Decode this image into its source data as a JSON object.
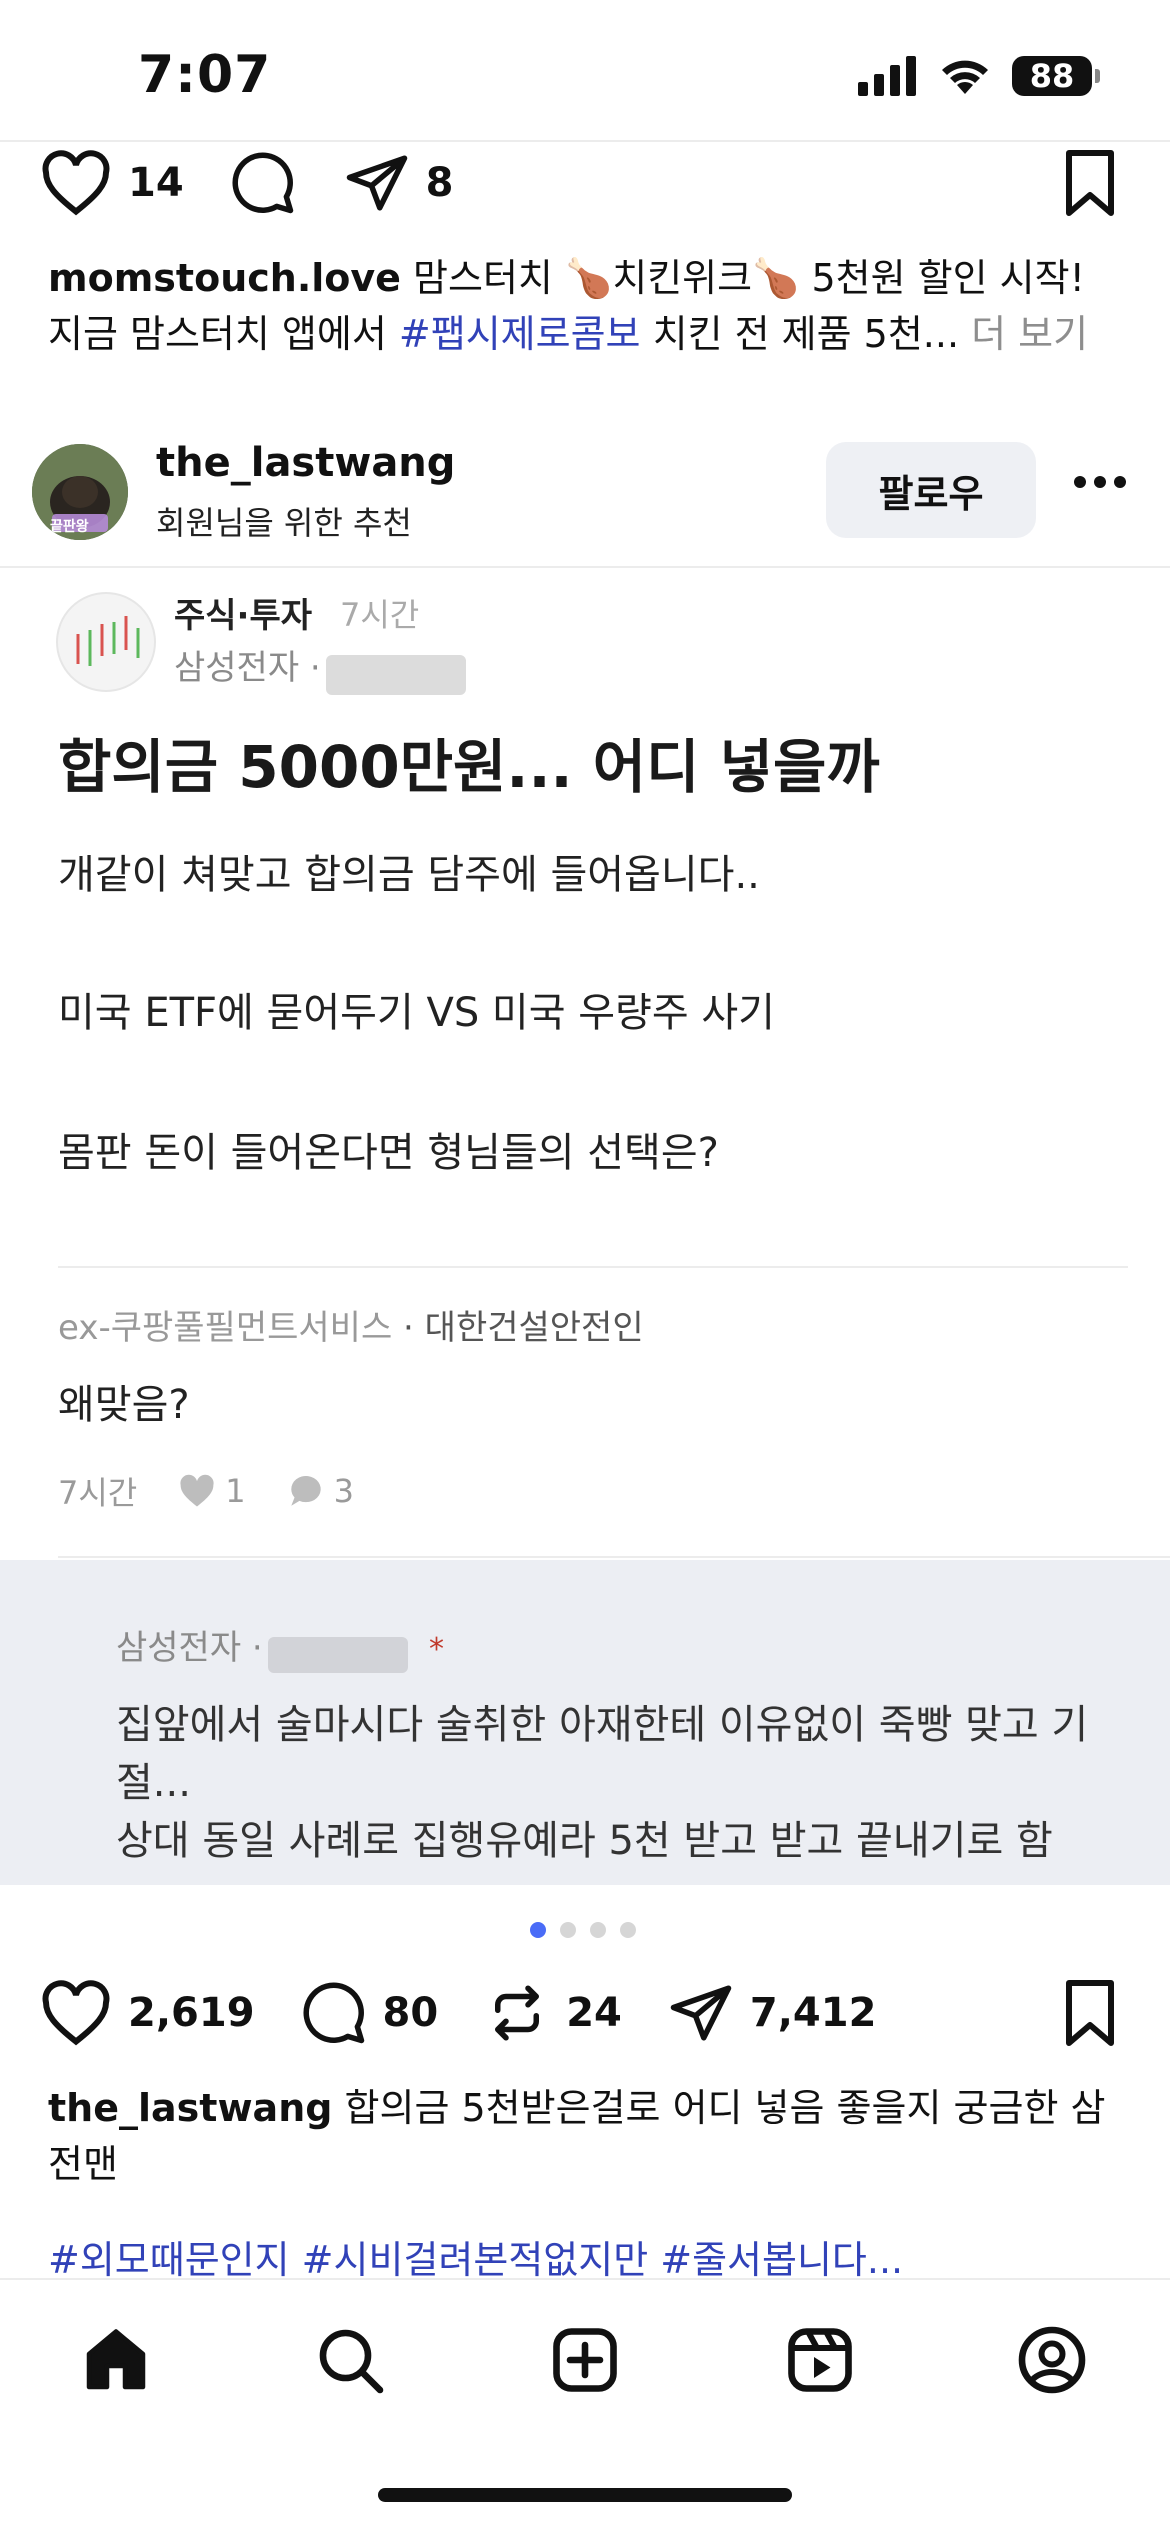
{
  "status": {
    "time": "7:07",
    "battery": "88"
  },
  "post1": {
    "likes": "14",
    "shares": "8",
    "caption_user": "momstouch.love",
    "caption_line1": "맘스터치 🍗치킨위크🍗 5천원 할인 시작!",
    "caption_line2_pre": "지금 맘스터치 앱에서",
    "caption_hashtag": "#팹시제로콤보",
    "caption_line2_post": "치킨 전 제품 5천...",
    "more": "더 보기"
  },
  "post2": {
    "username": "the_lastwang",
    "subtitle": "회원님을 위한 추천",
    "follow_label": "팔로우",
    "avatar_tag": "끝판왕",
    "card": {
      "board": "주식·투자",
      "time": "7시간",
      "company": "삼성전자 ·",
      "title": "합의금 5000만원... 어디 넣을까",
      "body_line1": "개같이 쳐맞고 합의금 담주에 들어옵니다..",
      "body_line2": "미국 ETF에 묻어두기 VS 미국 우량주 사기",
      "body_line3": "몸판 돈이 들어온다면 형님들의 선택은?",
      "comment_author": "ex-쿠팡풀필먼트서비스",
      "comment_author2": "· 대한건설안전인",
      "comment_text": "왜맞음?",
      "comment_time": "7시간",
      "comment_likes": "1",
      "comment_replies": "3",
      "reply_company": "삼성전자 ·",
      "reply_star": "*",
      "reply_line1": "집앞에서 술마시다 술취한 아재한테 이유없이 죽빵 맞고 기",
      "reply_line2": "절...",
      "reply_line3": "상대 동일 사례로 집행유예라 5천 받고 받고 끝내기로 함"
    },
    "likes": "2,619",
    "comments": "80",
    "reposts": "24",
    "shares": "7,412",
    "caption_user": "the_lastwang",
    "caption_text": "합의금 5천받은걸로 어디 넣음 좋을지 궁금한 삼",
    "caption_text2": "전맨",
    "hashtags": "#외모때문인지 #시비걸려본적없지만 #줄서봅니다..."
  },
  "nav": [
    "home",
    "search",
    "create",
    "reels",
    "profile"
  ]
}
